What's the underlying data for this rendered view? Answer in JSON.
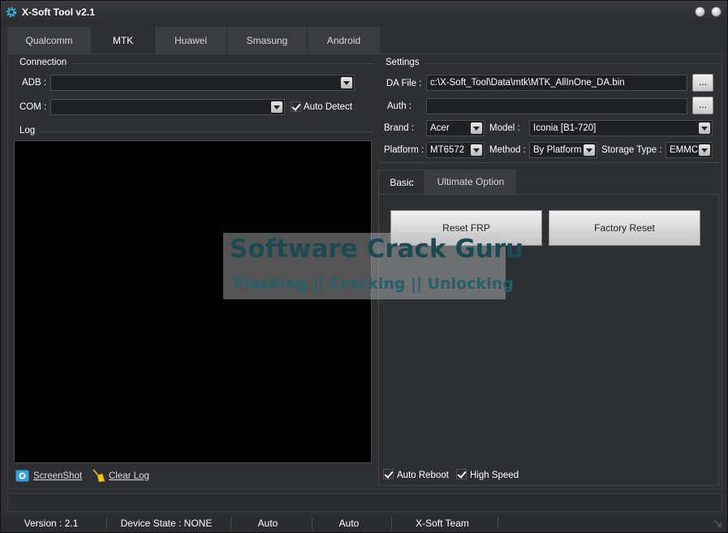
{
  "window": {
    "title": "X-Soft Tool v2.1"
  },
  "tabs": [
    "Qualcomm",
    "MTK",
    "Huawei",
    "Smasung",
    "Android"
  ],
  "active_tab": "MTK",
  "connection": {
    "group_label": "Connection",
    "adb_label": "ADB :",
    "adb_value": "",
    "com_label": "COM :",
    "com_value": "",
    "auto_detect_label": "Auto Detect",
    "auto_detect_checked": true
  },
  "log": {
    "group_label": "Log",
    "screenshot_label": "ScreenShot",
    "clear_log_label": "Clear Log"
  },
  "settings": {
    "group_label": "Settings",
    "da_file_label": "DA File :",
    "da_file_value": "c:\\X-Soft_Tool\\Data\\mtk\\MTK_AllInOne_DA.bin",
    "browse_label": "...",
    "auth_label": "Auth :",
    "auth_value": "",
    "brand_label": "Brand :",
    "brand_value": "Acer",
    "model_label": "Model :",
    "model_value": "Iconia [B1-720]",
    "platform_label": "Platform :",
    "platform_value": "MT6572",
    "method_label": "Method :",
    "method_value": "By Platform",
    "storage_label": "Storage Type :",
    "storage_value": "EMMC"
  },
  "subtabs": [
    "Basic",
    "Ultimate Option"
  ],
  "basic": {
    "reset_frp_label": "Reset FRP",
    "factory_reset_label": "Factory Reset"
  },
  "options": {
    "auto_reboot_label": "Auto Reboot",
    "auto_reboot_checked": true,
    "high_speed_label": "High Speed",
    "high_speed_checked": true
  },
  "watermark": {
    "title": "Software Crack Guru",
    "subtitle": "Flashing || Cracking || Unlocking"
  },
  "statusbar": {
    "version": "Version : 2.1",
    "device_state": "Device State : NONE",
    "auto1": "Auto",
    "auto2": "Auto",
    "team": "X-Soft Team"
  },
  "colors": {
    "background": "#2d2f33",
    "log_background": "#000000",
    "icon_accent": "#3ab0e0"
  }
}
